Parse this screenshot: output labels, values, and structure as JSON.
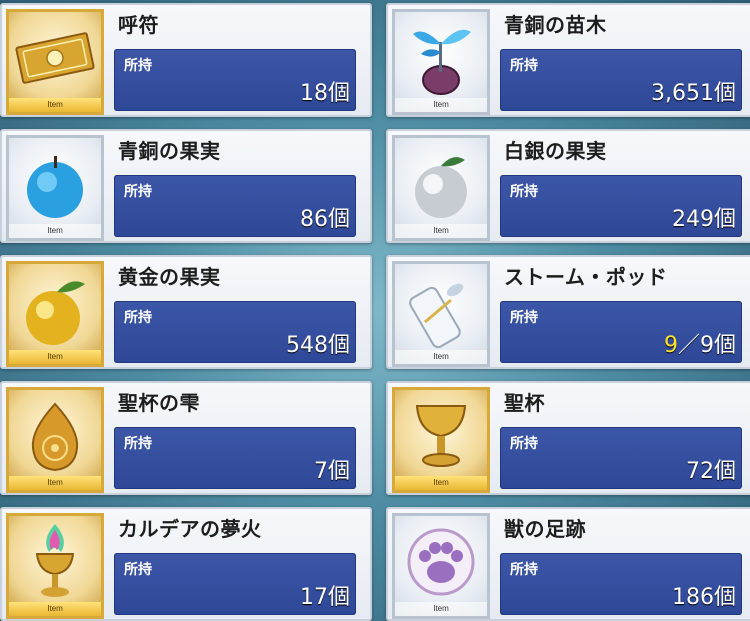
{
  "common": {
    "owned_label": "所持",
    "item_tag": "Item",
    "unit": "個"
  },
  "items": [
    {
      "name": "呼符",
      "count": "18個",
      "frame": "gold",
      "icon": "summon-ticket-icon"
    },
    {
      "name": "青銅の苗木",
      "count": "3,651個",
      "frame": "silver",
      "icon": "bronze-sapling-icon"
    },
    {
      "name": "青銅の果実",
      "count": "86個",
      "frame": "silver",
      "icon": "bronze-fruit-icon"
    },
    {
      "name": "白銀の果実",
      "count": "249個",
      "frame": "silver",
      "icon": "silver-fruit-icon"
    },
    {
      "name": "黄金の果実",
      "count": "548個",
      "frame": "gold",
      "icon": "gold-fruit-icon"
    },
    {
      "name": "ストーム・ポッド",
      "count_current": "9",
      "count_sep": "／",
      "count_max": "9個",
      "frame": "silver",
      "icon": "storm-pod-icon"
    },
    {
      "name": "聖杯の雫",
      "count": "7個",
      "frame": "gold",
      "icon": "grail-drop-icon"
    },
    {
      "name": "聖杯",
      "count": "72個",
      "frame": "gold",
      "icon": "holy-grail-icon"
    },
    {
      "name": "カルデアの夢火",
      "count": "17個",
      "frame": "gold",
      "icon": "chaldea-lantern-icon"
    },
    {
      "name": "獣の足跡",
      "count": "186個",
      "frame": "silver",
      "icon": "beast-footprint-icon"
    }
  ],
  "colors": {
    "panel_blue": "#3d57a8",
    "highlight": "#ffe22a",
    "gold_frame": "#d7a93a"
  }
}
